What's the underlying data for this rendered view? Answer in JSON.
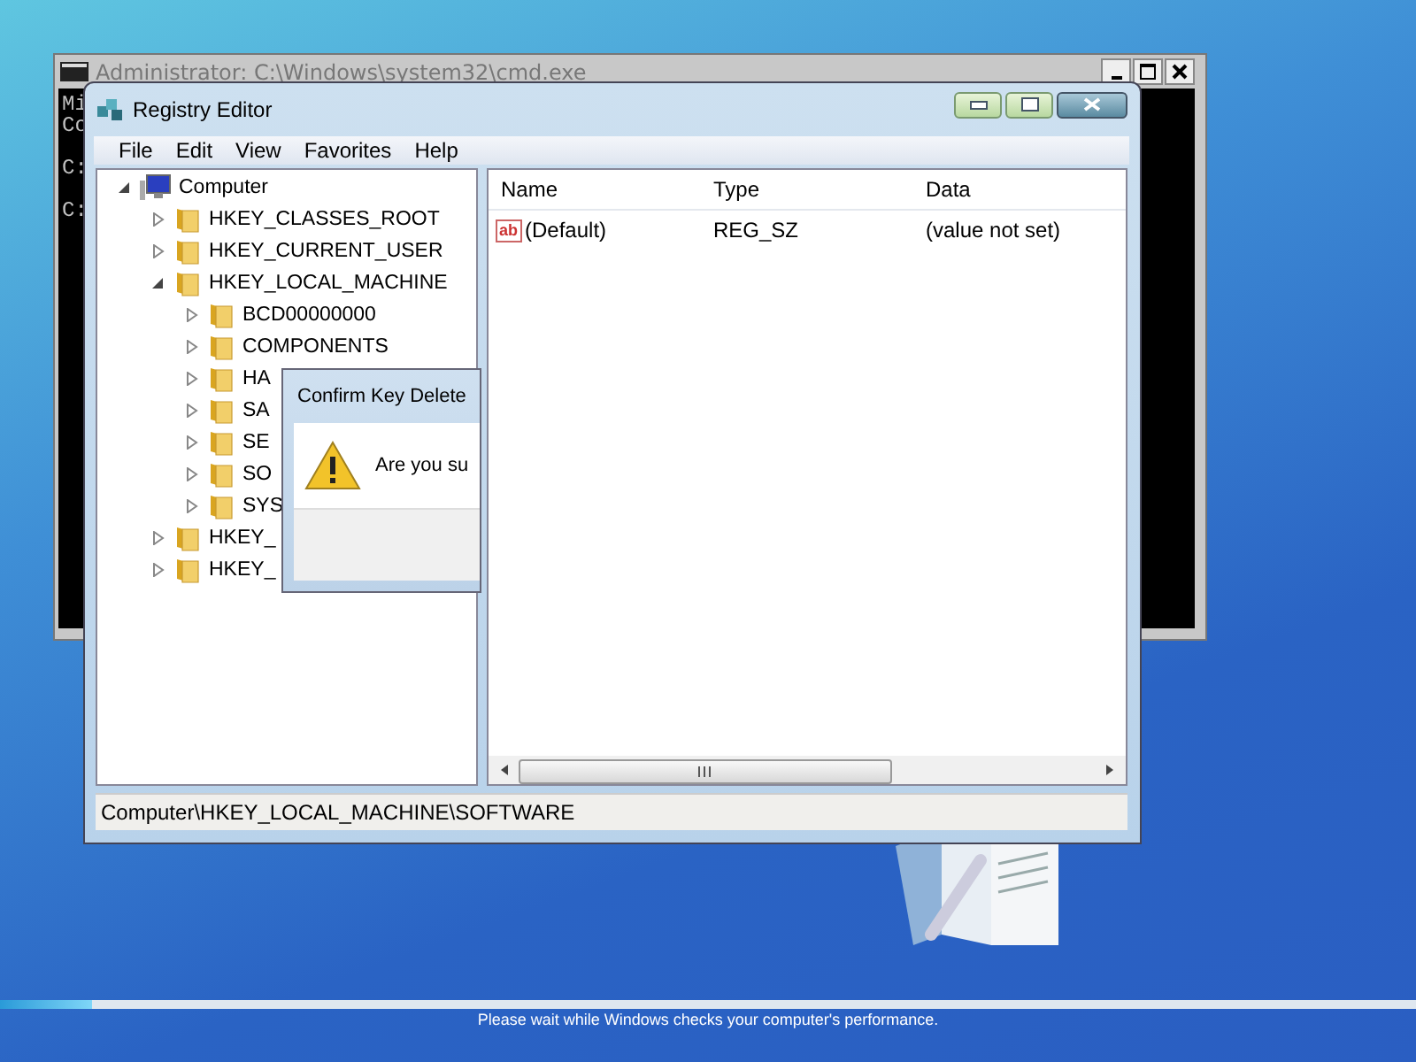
{
  "cmd_window": {
    "title": "Administrator: C:\\Windows\\system32\\cmd.exe",
    "console_lines": [
      {
        "kind": "text",
        "text": "Mi"
      },
      {
        "kind": "text",
        "text": "Co"
      },
      {
        "kind": "blank"
      },
      {
        "kind": "text",
        "text": "C:"
      },
      {
        "kind": "blank"
      },
      {
        "kind": "text",
        "text": "C:"
      }
    ]
  },
  "registry_editor": {
    "title": "Registry Editor",
    "menu": [
      "File",
      "Edit",
      "View",
      "Favorites",
      "Help"
    ],
    "tree": [
      {
        "label": "Computer",
        "kind": "computer",
        "expanded": true,
        "children": [
          {
            "label": "HKEY_CLASSES_ROOT",
            "kind": "folder",
            "expanded": false
          },
          {
            "label": "HKEY_CURRENT_USER",
            "kind": "folder",
            "expanded": false
          },
          {
            "label": "HKEY_LOCAL_MACHINE",
            "kind": "folder",
            "expanded": true,
            "children": [
              {
                "label": "BCD00000000",
                "kind": "folder",
                "expanded": false
              },
              {
                "label": "COMPONENTS",
                "kind": "folder",
                "expanded": false
              },
              {
                "label": "HA",
                "kind": "folder",
                "expanded": false
              },
              {
                "label": "SA",
                "kind": "folder",
                "expanded": false
              },
              {
                "label": "SE",
                "kind": "folder",
                "expanded": false
              },
              {
                "label": "SO",
                "kind": "folder",
                "expanded": false
              },
              {
                "label": "SYS",
                "kind": "folder",
                "expanded": false
              }
            ]
          },
          {
            "label": "HKEY_",
            "kind": "folder",
            "expanded": false
          },
          {
            "label": "HKEY_",
            "kind": "folder",
            "expanded": false
          }
        ]
      }
    ],
    "columns": [
      "Name",
      "Type",
      "Data"
    ],
    "rows": [
      {
        "kind": "string",
        "icon_text": "ab",
        "name": "(Default)",
        "type": "REG_SZ",
        "data": "(value not set)"
      }
    ],
    "status_bar": "Computer\\HKEY_LOCAL_MACHINE\\SOFTWARE"
  },
  "dialog": {
    "title": "Confirm Key Delete",
    "message": "Are you su"
  },
  "footer": {
    "progress": {
      "level": 0.065
    },
    "message": "Please wait while Windows checks your computer's performance."
  }
}
